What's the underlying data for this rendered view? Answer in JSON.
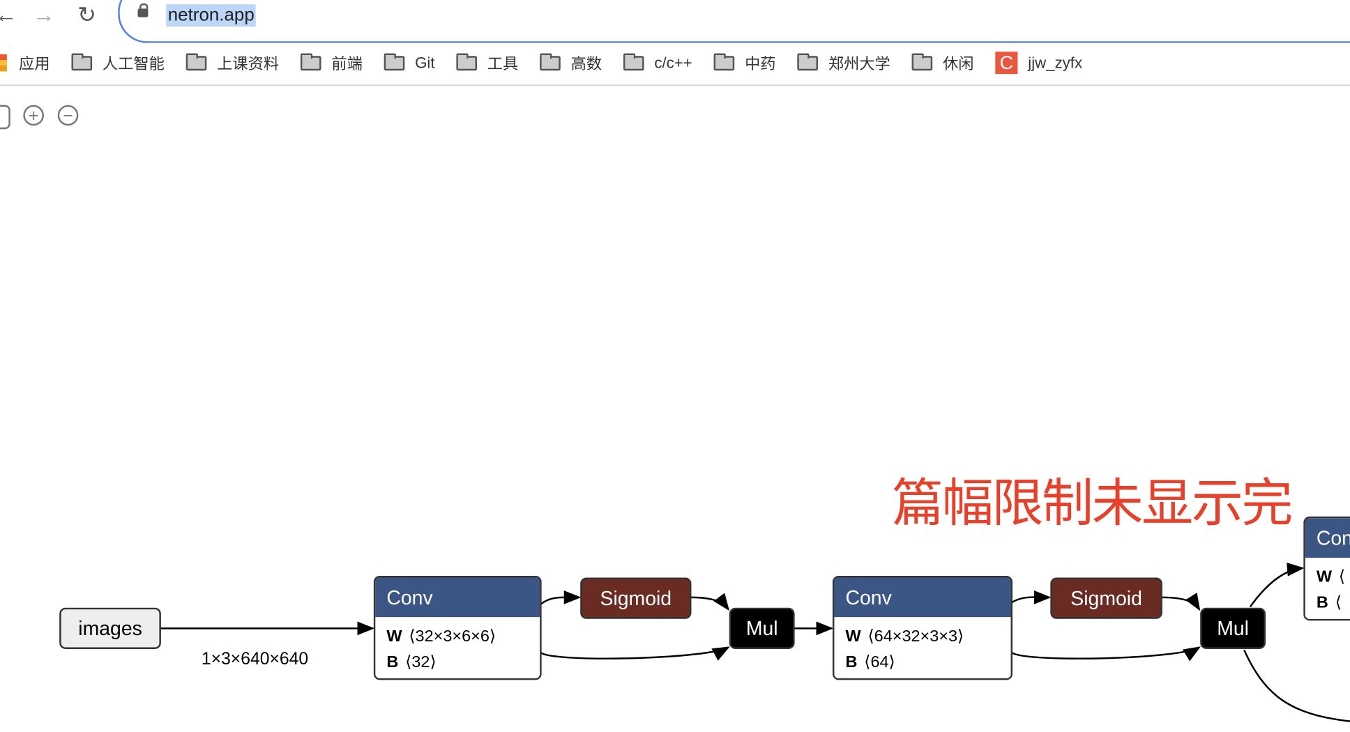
{
  "browser": {
    "url": "netron.app",
    "back_icon": "arrow-left-icon",
    "forward_icon": "arrow-right-icon",
    "reload_icon": "reload-icon",
    "lock_icon": "lock-icon"
  },
  "bookmarks": [
    {
      "label": "应用",
      "icon": "apps-grid-icon"
    },
    {
      "label": "人工智能"
    },
    {
      "label": "上课资料"
    },
    {
      "label": "前端"
    },
    {
      "label": "Git"
    },
    {
      "label": "工具"
    },
    {
      "label": "高数"
    },
    {
      "label": "c/c++"
    },
    {
      "label": "中药"
    },
    {
      "label": "郑州大学"
    },
    {
      "label": "休闲"
    },
    {
      "label": "jjw_zyfx",
      "icon": "csdn-c-icon"
    }
  ],
  "toolbar": {
    "zoom_in": "+",
    "zoom_out": "−"
  },
  "annotation": "篇幅限制未显示完",
  "graph": {
    "input": {
      "label": "images",
      "shape": "1×3×640×640"
    },
    "nodes": [
      {
        "type": "Conv",
        "W": "⟨32×3×6×6⟩",
        "B": "⟨32⟩"
      },
      {
        "type": "Sigmoid"
      },
      {
        "type": "Mul"
      },
      {
        "type": "Conv",
        "W": "⟨64×32×3×3⟩",
        "B": "⟨64⟩"
      },
      {
        "type": "Sigmoid"
      },
      {
        "type": "Mul"
      },
      {
        "type": "Conv",
        "W": "⟨",
        "B": "⟨"
      }
    ],
    "colors": {
      "conv": "#3b5584",
      "sigmoid": "#6a2b22",
      "mul": "#000000",
      "input": "#eeeeee"
    }
  }
}
